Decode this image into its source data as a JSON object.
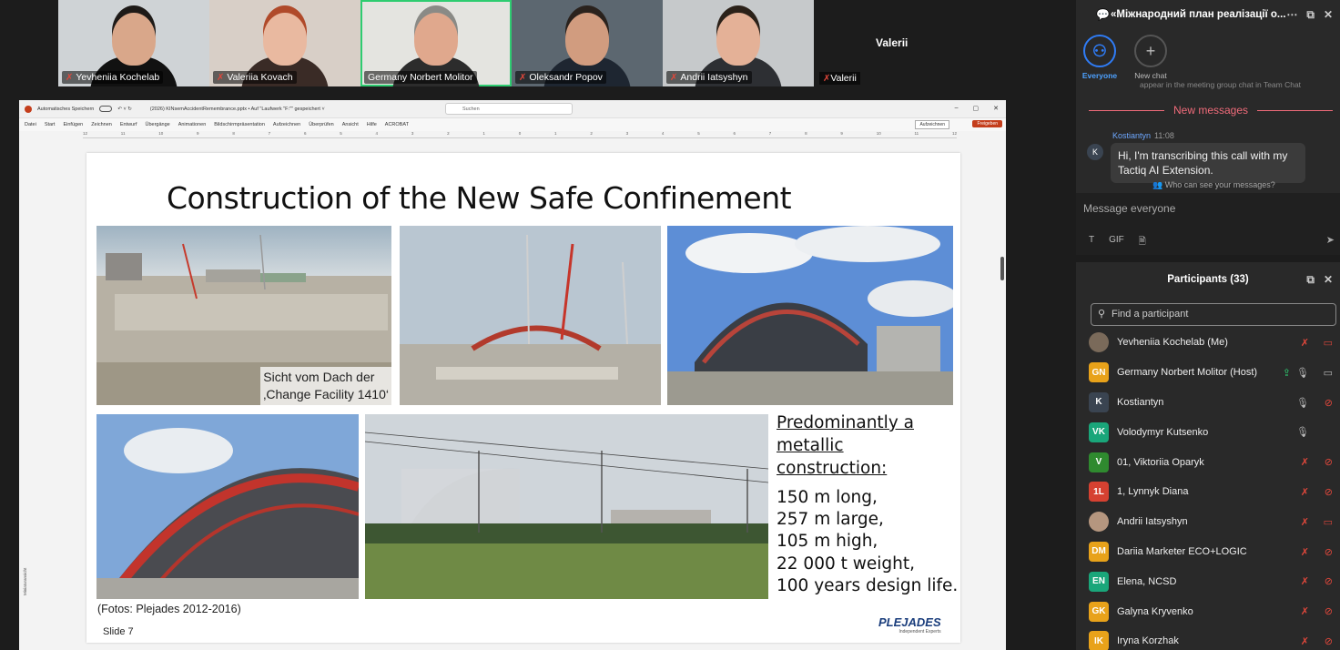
{
  "video_strip": [
    {
      "name": "Yevheniia Kochelab",
      "muted": true,
      "bg": "#cfd3d6",
      "skin": "#d9a78a",
      "hair": "#1e1a18",
      "shirt": "#111111",
      "active": false
    },
    {
      "name": "Valeriia Kovach",
      "muted": true,
      "bg": "#d8cfc7",
      "skin": "#e9b9a0",
      "hair": "#b04a2a",
      "shirt": "#3a2b26",
      "active": false
    },
    {
      "name": "Germany Norbert Molitor",
      "muted": false,
      "bg": "#e4e4e0",
      "skin": "#e0a88d",
      "hair": "#8a8a86",
      "shirt": "#2c2c2c",
      "active": true
    },
    {
      "name": "Oleksandr Popov",
      "muted": true,
      "bg": "#5c6770",
      "skin": "#d19c7f",
      "hair": "#2a221d",
      "shirt": "#1e2631",
      "active": false
    },
    {
      "name": "Andrii Iatsyshyn",
      "muted": true,
      "bg": "#c6c9cb",
      "skin": "#e4b197",
      "hair": "#2b2119",
      "shirt": "#2d2f33",
      "active": false
    }
  ],
  "extra_tile": {
    "big_label": "Valerii",
    "name": "Valerii",
    "muted": true
  },
  "ppt": {
    "autosave": "Automatisches Speichern",
    "filename": "(2026) KINsemAccidentRemembrance.pptx • Auf \"Laufwerk \"F:\"\" gespeichert ˅",
    "search": "Suchen",
    "menu": [
      "Datei",
      "Start",
      "Einfügen",
      "Zeichnen",
      "Entwurf",
      "Übergänge",
      "Animationen",
      "Bildschirmpräsentation",
      "Aufzeichnen",
      "Überprüfen",
      "Ansicht",
      "Hilfe",
      "ACROBAT"
    ],
    "record_btn": "Aufzeichnen",
    "share_btn": "Freigeben",
    "sidebar_label": "Miniaturansicht",
    "ruler": [
      "12",
      "11",
      "10",
      "9",
      "8",
      "7",
      "6",
      "5",
      "4",
      "3",
      "2",
      "1",
      "0",
      "1",
      "2",
      "3",
      "4",
      "5",
      "6",
      "7",
      "8",
      "9",
      "10",
      "11",
      "12"
    ]
  },
  "slide": {
    "title": "Construction of the New Safe Confinement",
    "photo1_caption_line1": "Sicht vom Dach der",
    "photo1_caption_line2": "‚Change Facility 1410‘",
    "heading_line1": "Predominantly a",
    "heading_line2": "metallic",
    "heading_line3": "construction:",
    "facts": [
      "150 m long,",
      "257 m large,",
      "105 m high,",
      "22 000 t weight,",
      "100 years design life."
    ],
    "credit": "(Fotos: Plejades 2012-2016)",
    "slide_number": "Slide 7",
    "logo": "PLEJADES",
    "logo_sub": "Independent Experts"
  },
  "chat": {
    "title": "«Міжнародний план реалізації о...",
    "tabs": [
      {
        "label": "Everyone",
        "icon": "people-icon",
        "selected": true
      },
      {
        "label": "New chat",
        "icon": "plus-icon",
        "selected": false
      }
    ],
    "faded_text": "appear in the meeting group chat in Team Chat",
    "new_messages": "New messages",
    "message": {
      "author": "Kostiantyn",
      "time": "11:08",
      "initial": "K",
      "text": "Hi, I'm transcribing this call with my Tactiq AI Extension."
    },
    "privacy": "Who can see your messages?",
    "compose_placeholder": "Message everyone",
    "tools": [
      "T",
      "GIF",
      "file-icon"
    ]
  },
  "participants": {
    "title": "Participants (33)",
    "search_placeholder": "Find a participant",
    "list": [
      {
        "initials": "",
        "photo": true,
        "photo_color": "#7a6a5a",
        "name": "Yevheniia Kochelab (Me)",
        "mic": "off",
        "video": "off-plain"
      },
      {
        "initials": "GN",
        "color": "#e8a21a",
        "name": "Germany Norbert Molitor (Host)",
        "share": true,
        "mic": "on",
        "video": "on"
      },
      {
        "initials": "K",
        "color": "#3a4451",
        "name": "Kostiantyn",
        "mic": "on",
        "video": "off"
      },
      {
        "initials": "VK",
        "color": "#1aa67a",
        "name": "Volodymyr Kutsenko",
        "mic": "on",
        "video": ""
      },
      {
        "initials": "V",
        "color": "#2f8a2f",
        "name": "01, Viktoriia Oparyk",
        "mic": "off",
        "video": "off"
      },
      {
        "initials": "1L",
        "color": "#d64131",
        "name": "1, Lynnyk Diana",
        "mic": "off",
        "video": "off"
      },
      {
        "initials": "",
        "photo": true,
        "photo_color": "#b5967f",
        "name": "Andrii Iatsyshyn",
        "mic": "off",
        "video": "off-plain"
      },
      {
        "initials": "DM",
        "color": "#e8a21a",
        "name": "Dariia Marketer ECO+LOGIC",
        "mic": "off",
        "video": "off"
      },
      {
        "initials": "EN",
        "color": "#1aa67a",
        "name": "Elena, NCSD",
        "mic": "off",
        "video": "off"
      },
      {
        "initials": "GK",
        "color": "#e8a21a",
        "name": "Galyna Kryvenko",
        "mic": "off",
        "video": "off"
      },
      {
        "initials": "IK",
        "color": "#e8a21a",
        "name": "Iryna Korzhak",
        "mic": "off",
        "video": "off"
      }
    ]
  }
}
